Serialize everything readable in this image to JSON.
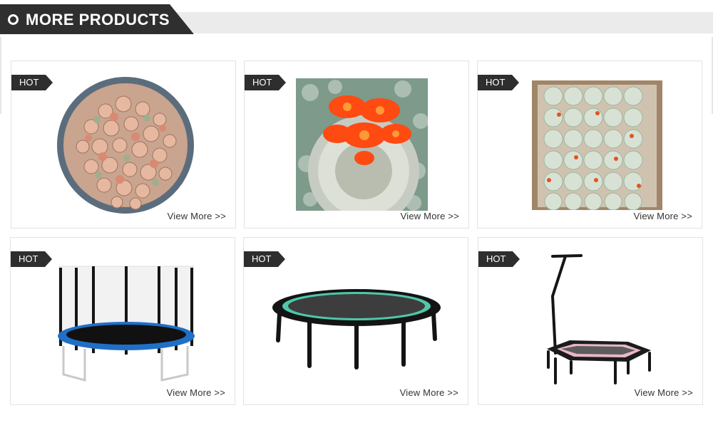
{
  "section": {
    "title": "MORE PRODUCTS"
  },
  "badge_label": "HOT",
  "view_more_label": "View More >>",
  "products": [
    {
      "image": "succulent-pot-image",
      "badge": "HOT",
      "link": "View More >>"
    },
    {
      "image": "flowering-cactus-image",
      "badge": "HOT",
      "link": "View More >>"
    },
    {
      "image": "boxed-cacti-image",
      "badge": "HOT",
      "link": "View More >>"
    },
    {
      "image": "enclosed-trampoline-image",
      "badge": "HOT",
      "link": "View More >>"
    },
    {
      "image": "round-bungee-trampoline-image",
      "badge": "HOT",
      "link": "View More >>"
    },
    {
      "image": "hexagon-handle-trampoline-image",
      "badge": "HOT",
      "link": "View More >>"
    }
  ],
  "colors": {
    "header_dark": "#2f2f2f",
    "header_strip": "#ebebeb",
    "card_border": "#e2e2e2",
    "badge": "#2e2e2e"
  }
}
